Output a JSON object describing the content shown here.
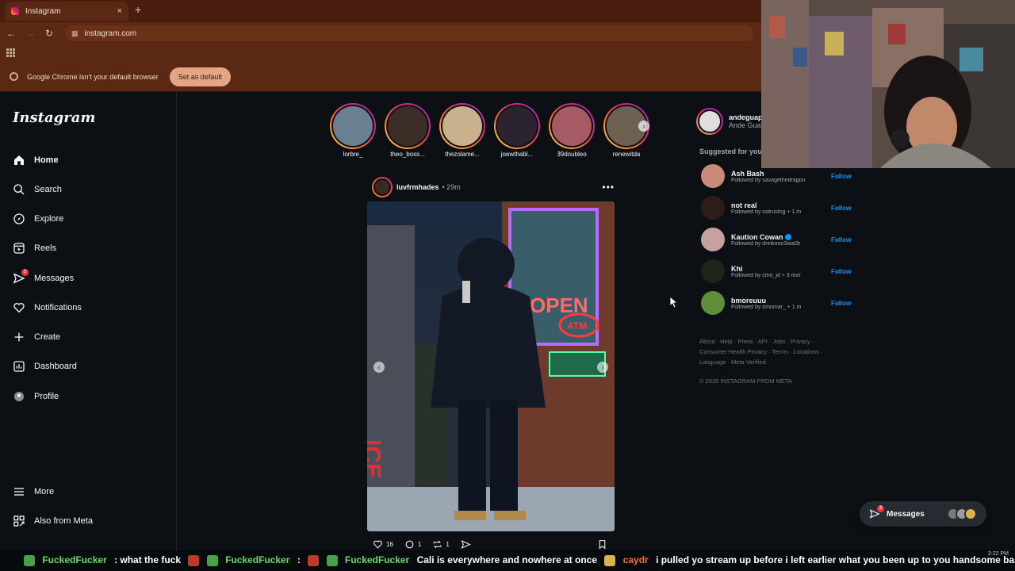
{
  "browser": {
    "tab_title": "Instagram",
    "tab_close": "×",
    "new_tab": "+",
    "url": "instagram.com",
    "infobar_text": "Google Chrome isn't your default browser",
    "infobar_button": "Set as default"
  },
  "sidebar": {
    "logo": "Instagram",
    "items": [
      {
        "label": "Home",
        "icon": "home-icon"
      },
      {
        "label": "Search",
        "icon": "search-icon"
      },
      {
        "label": "Explore",
        "icon": "compass-icon"
      },
      {
        "label": "Reels",
        "icon": "reels-icon"
      },
      {
        "label": "Messages",
        "icon": "messenger-icon",
        "badge": "3"
      },
      {
        "label": "Notifications",
        "icon": "heart-icon"
      },
      {
        "label": "Create",
        "icon": "plus-icon"
      },
      {
        "label": "Dashboard",
        "icon": "dashboard-icon"
      },
      {
        "label": "Profile",
        "icon": "profile-icon"
      }
    ],
    "more": "More",
    "also_from_meta": "Also from Meta"
  },
  "stories": [
    {
      "name": "lorbre_",
      "color": "#6a7f92"
    },
    {
      "name": "theo_boss...",
      "color": "#3c2d26"
    },
    {
      "name": "thezolame...",
      "color": "#c9b18e"
    },
    {
      "name": "joewthabl...",
      "color": "#2b2430"
    },
    {
      "name": "39doubleo",
      "color": "#a65a64"
    },
    {
      "name": "renewitda",
      "color": "#6f6152"
    }
  ],
  "post": {
    "username": "luvfrmhades",
    "time": "• 29m",
    "more": "•••",
    "likes": "16",
    "comments": "1",
    "reposts": "1",
    "sign_text": "OPEN",
    "atm_text": "ATM",
    "ice_text": "ICE"
  },
  "right": {
    "username": "andeguap",
    "fullname": "Ande Gua",
    "suggested_title": "Suggested for you",
    "suggestions": [
      {
        "name": "Ash Bash",
        "followed_by": "Followed by savagethedragon",
        "color": "#c98b77"
      },
      {
        "name": "not real",
        "followed_by": "Followed by notrustng + 1 m",
        "color": "#2c1e16"
      },
      {
        "name": "Kaution Cowan",
        "followed_by": "Followed by drinkmor3wat3r",
        "color": "#c9a0a0",
        "verified": true
      },
      {
        "name": "Khi",
        "followed_by": "Followed by cmo_jd + 3 mor",
        "color": "#1f2419"
      },
      {
        "name": "bmoreuuu",
        "followed_by": "Followed by omnmar_ + 1 m",
        "color": "#5f8e3a"
      }
    ],
    "follow_label": "Follow",
    "footer_links": "About · Help · Press · API · Jobs · Privacy · Consumer Health Privacy · Terms · Locations · Language · Meta Verified",
    "copyright": "© 2026 INSTAGRAM FROM META"
  },
  "messages_pill": {
    "label": "Messages",
    "badge": "3"
  },
  "chat": {
    "user1": "FuckedFucker",
    "msg1": ": what the fuck",
    "user2": "FuckedFucker",
    "msg2": ":",
    "user3": "FuckedFucker",
    "msg3": "Cali is everywhere and nowhere at once",
    "user4": "caydr",
    "msg4": "i pulled yo stream up before i left earlier what you been up to you handsome bastard",
    "clock": "2:22 PM"
  }
}
